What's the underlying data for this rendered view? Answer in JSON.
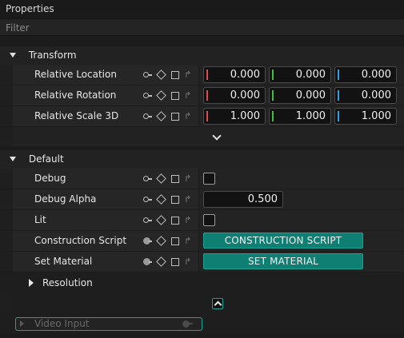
{
  "panel": {
    "title": "Properties"
  },
  "filter": {
    "placeholder": "Filter"
  },
  "sections": {
    "transform": {
      "title": "Transform",
      "rows": [
        {
          "label": "Relative Location",
          "x": "0.000",
          "y": "0.000",
          "z": "0.000"
        },
        {
          "label": "Relative Rotation",
          "x": "0.000",
          "y": "0.000",
          "z": "0.000"
        },
        {
          "label": "Relative Scale 3D",
          "x": "1.000",
          "y": "1.000",
          "z": "1.000"
        }
      ]
    },
    "default": {
      "title": "Default",
      "debug": {
        "label": "Debug",
        "checked": false
      },
      "debug_alpha": {
        "label": "Debug Alpha",
        "value": "0.500"
      },
      "lit": {
        "label": "Lit",
        "checked": false
      },
      "construction_script": {
        "label": "Construction Script",
        "button": "CONSTRUCTION SCRIPT"
      },
      "set_material": {
        "label": "Set Material",
        "button": "SET MATERIAL"
      },
      "resolution": {
        "label": "Resolution"
      }
    }
  },
  "video_input": {
    "label": "Video Input"
  },
  "icons": {
    "key": "key-icon",
    "diamond": "keyframe-diamond-icon",
    "square": "square-icon",
    "reset": "reset-arrow-icon",
    "chevron_down": "chevron-down-icon",
    "chevron_up": "chevron-up-icon",
    "caret_down": "caret-down-icon",
    "caret_right": "caret-right-icon"
  },
  "colors": {
    "axis_x": "#e0484a",
    "axis_y": "#3fbf3f",
    "axis_z": "#2f9fe8",
    "accent": "#0f7f73",
    "accent_border": "#1aa394"
  }
}
